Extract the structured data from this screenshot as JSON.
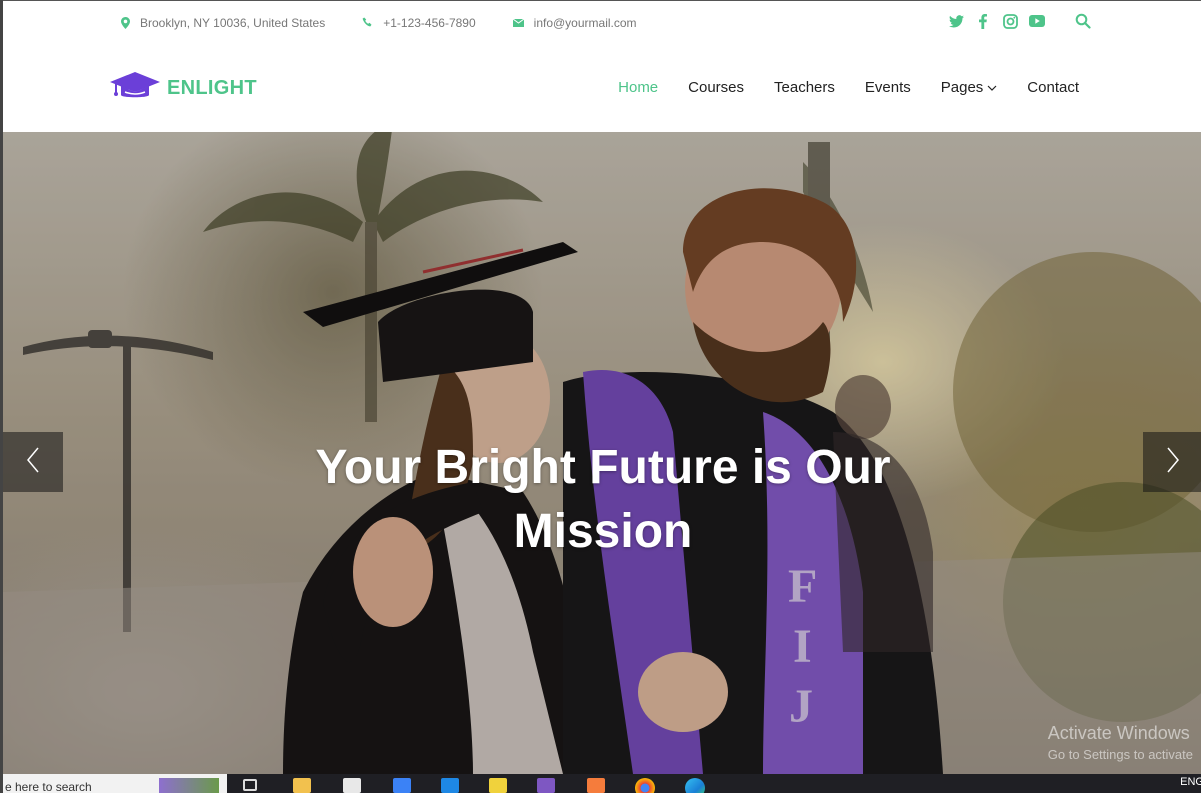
{
  "topbar": {
    "address": "Brooklyn, NY 10036, United States",
    "phone": "+1-123-456-7890",
    "email": "info@yourmail.com",
    "icons": [
      "location-icon",
      "phone-icon",
      "mail-icon",
      "twitter-icon",
      "facebook-icon",
      "instagram-icon",
      "youtube-icon",
      "search-icon"
    ]
  },
  "header": {
    "logo_text": "ENLIGHT",
    "nav": [
      {
        "label": "Home",
        "active": true
      },
      {
        "label": "Courses"
      },
      {
        "label": "Teachers"
      },
      {
        "label": "Events"
      },
      {
        "label": "Pages",
        "has_dropdown": true
      },
      {
        "label": "Contact"
      }
    ]
  },
  "hero": {
    "headline": "Your Bright Future is Our Mission"
  },
  "os": {
    "watermark_title": "Activate Windows",
    "watermark_sub": "Go to Settings to activate",
    "search_placeholder": "e here to search",
    "lang": "ENG"
  },
  "colors": {
    "accent": "#4ec48a",
    "logo_icon": "#6b3fd8"
  }
}
